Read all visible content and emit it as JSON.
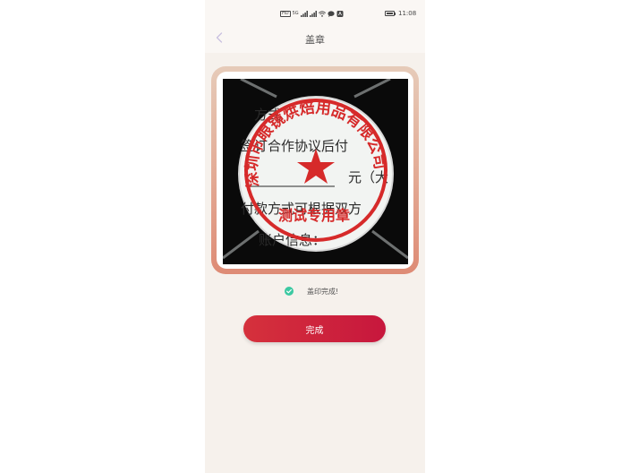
{
  "status_bar": {
    "network_text": "HD",
    "signal_text": "5G",
    "time": "11:08"
  },
  "header": {
    "title": "盖章",
    "back_icon": "chevron-left-icon"
  },
  "stamp_preview": {
    "seal_text": "深圳市眼镜烘焙用品有限公司",
    "seal_subtext": "测试专用章",
    "document_lines": [
      "方式",
      "签订合作协议后付",
      "元（大",
      "付款方式可根据双方",
      "账户信息："
    ]
  },
  "status": {
    "text": "盖印完成!",
    "icon": "check-circle-icon",
    "color": "#3cc9a2"
  },
  "actions": {
    "done_label": "完成",
    "button_color": "#c91e3c"
  }
}
